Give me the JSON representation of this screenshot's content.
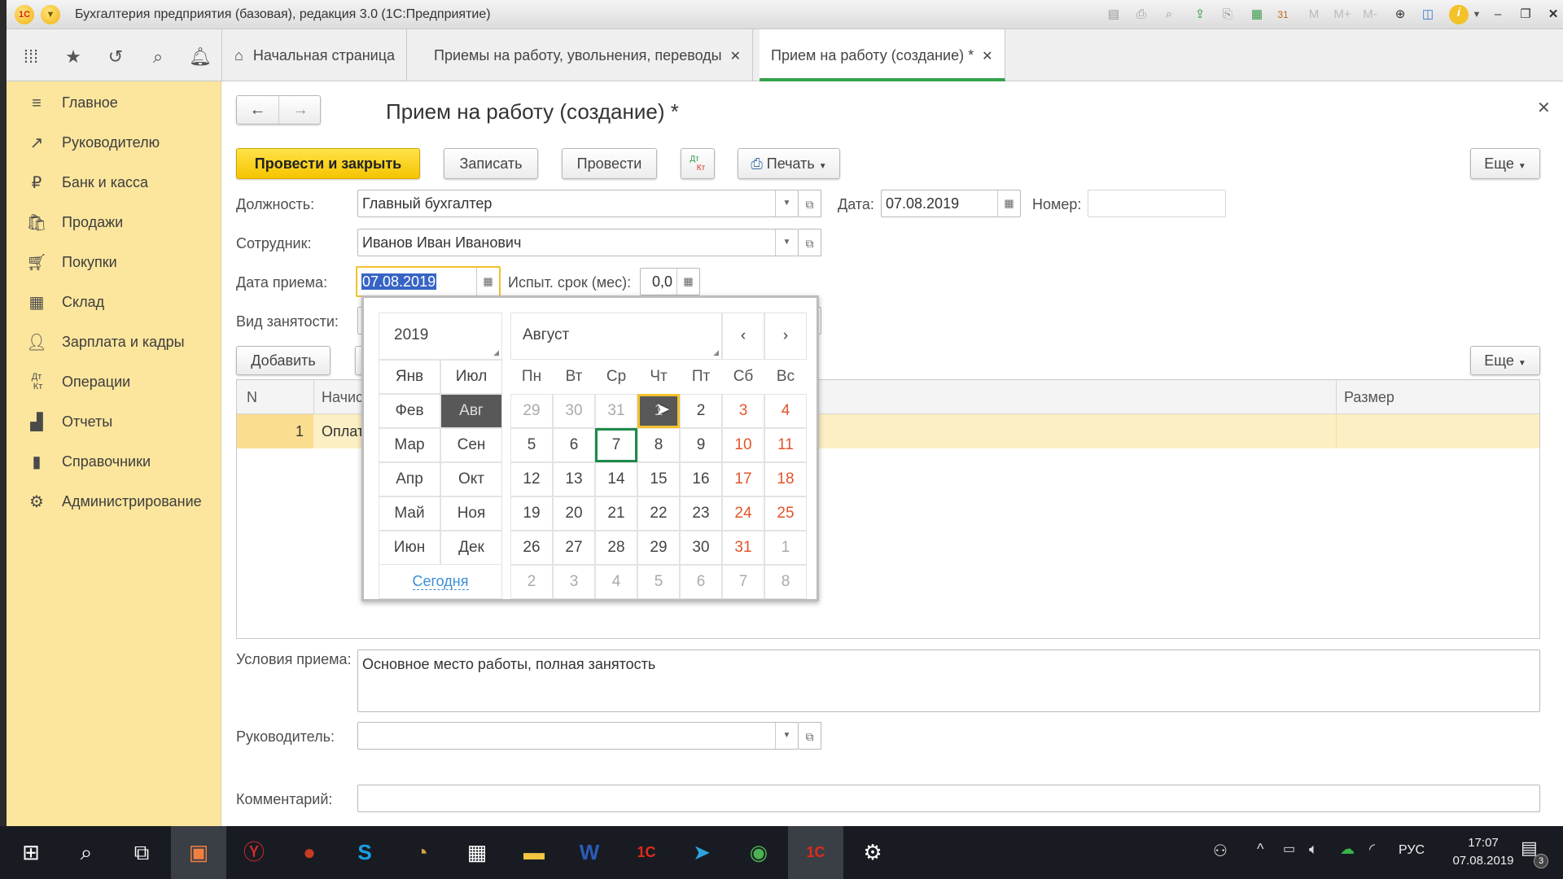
{
  "window": {
    "title": "Бухгалтерия предприятия (базовая), редакция 3.0  (1С:Предприятие)",
    "logo": "1С",
    "toolbar_icons": [
      "save-icon",
      "print-icon",
      "preview-icon",
      "upload-icon",
      "download-icon",
      "calculator-icon",
      "calendar-icon",
      "M",
      "M+",
      "M-",
      "zoom-icon",
      "panels-icon",
      "info-icon"
    ],
    "memory_labels": [
      "M",
      "M+",
      "M-"
    ]
  },
  "section_bar": {
    "tabs": [
      {
        "label": "Начальная страница",
        "closable": false
      },
      {
        "label": "Приемы на работу, увольнения, переводы",
        "closable": true
      },
      {
        "label": "Прием на работу (создание) *",
        "closable": true,
        "active": true
      }
    ]
  },
  "sidebar": {
    "items": [
      {
        "label": "Главное",
        "icon": "menu-icon"
      },
      {
        "label": "Руководителю",
        "icon": "trend-icon"
      },
      {
        "label": "Банк и касса",
        "icon": "ruble-icon"
      },
      {
        "label": "Продажи",
        "icon": "bag-icon"
      },
      {
        "label": "Покупки",
        "icon": "cart-icon"
      },
      {
        "label": "Склад",
        "icon": "warehouse-icon"
      },
      {
        "label": "Зарплата и кадры",
        "icon": "person-icon"
      },
      {
        "label": "Операции",
        "icon": "dt-kt-icon"
      },
      {
        "label": "Отчеты",
        "icon": "bar-chart-icon"
      },
      {
        "label": "Справочники",
        "icon": "books-icon"
      },
      {
        "label": "Администрирование",
        "icon": "gear-icon"
      }
    ]
  },
  "form": {
    "title": "Прием на работу (создание) *",
    "buttons": {
      "post_close": "Провести и закрыть",
      "save": "Записать",
      "post": "Провести",
      "dtkt_top": "Дт",
      "dtkt_bottom": "Кт",
      "print": "Печать",
      "more": "Еще"
    },
    "fields": {
      "position_label": "Должность:",
      "position_value": "Главный бухгалтер",
      "date_label": "Дата:",
      "date_value": "07.08.2019",
      "number_label": "Номер:",
      "number_value": "",
      "employee_label": "Сотрудник:",
      "employee_value": "Иванов Иван Иванович",
      "hire_date_label": "Дата приема:",
      "hire_date_value": "07.08.2019",
      "probation_label": "Испыт. срок (мес):",
      "probation_value": "0,0",
      "employment_type_label": "Вид занятости:",
      "conditions_label": "Условия приема:",
      "conditions_value": "Основное место работы, полная занятость",
      "manager_label": "Руководитель:",
      "manager_value": "",
      "comment_label": "Комментарий:",
      "comment_value": ""
    },
    "table": {
      "add_button": "Добавить",
      "more_button": "Еще",
      "columns": [
        "N",
        "Начисление",
        "Размер"
      ],
      "rows": [
        {
          "n": "1",
          "accrual": "Оплата",
          "size": ""
        }
      ]
    }
  },
  "calendar": {
    "year": "2019",
    "month": "Август",
    "prev": "‹",
    "next": "›",
    "months_left": [
      "Янв",
      "Фев",
      "Мар",
      "Апр",
      "Май",
      "Июн"
    ],
    "months_right": [
      "Июл",
      "Авг",
      "Сен",
      "Окт",
      "Ноя",
      "Дек"
    ],
    "selected_month": "Авг",
    "today_link": "Сегодня",
    "weekdays": [
      "Пн",
      "Вт",
      "Ср",
      "Чт",
      "Пт",
      "Сб",
      "Вс"
    ],
    "weeks": [
      [
        "29",
        "30",
        "31",
        "1",
        "2",
        "3",
        "4"
      ],
      [
        "5",
        "6",
        "7",
        "8",
        "9",
        "10",
        "11"
      ],
      [
        "12",
        "13",
        "14",
        "15",
        "16",
        "17",
        "18"
      ],
      [
        "19",
        "20",
        "21",
        "22",
        "23",
        "24",
        "25"
      ],
      [
        "26",
        "27",
        "28",
        "29",
        "30",
        "31",
        "1"
      ],
      [
        "2",
        "3",
        "4",
        "5",
        "6",
        "7",
        "8"
      ]
    ],
    "hovered_day": "1",
    "today_day": "7",
    "colors": {
      "weekend": "#e4542a",
      "today_border": "#1e8a4a",
      "hover_border": "#f2c12e",
      "selected_bg": "#585858"
    }
  },
  "taskbar": {
    "apps": [
      "start-icon",
      "search-icon",
      "task-view-icon",
      "presentation-app-icon",
      "yandex-browser-icon",
      "fruit-app-icon",
      "skype-icon",
      "clock-app-icon",
      "calculator-icon",
      "file-explorer-icon",
      "word-icon",
      "1c-icon",
      "telegram-icon",
      "chrome-icon",
      "1c-active-icon",
      "settings-icon"
    ],
    "tray": {
      "language": "РУС",
      "time": "17:07",
      "date": "07.08.2019",
      "notifications": "3"
    }
  }
}
